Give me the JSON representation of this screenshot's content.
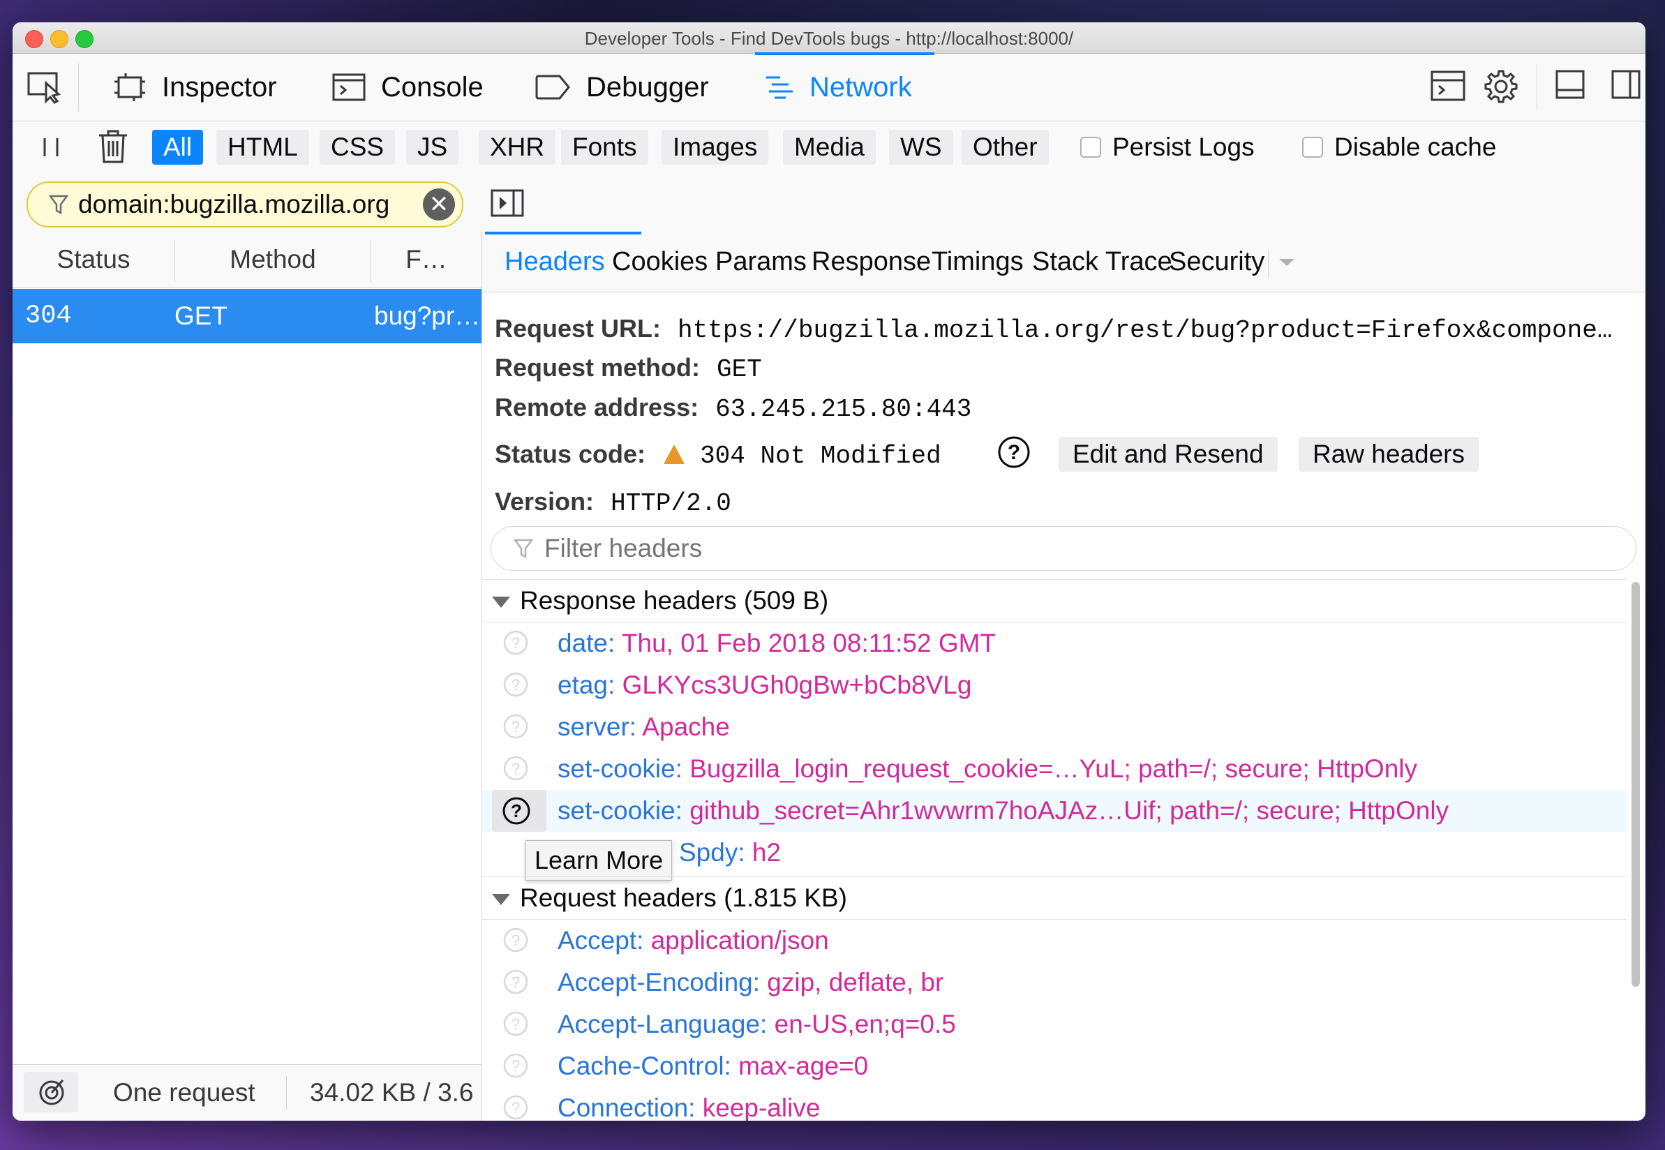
{
  "window": {
    "title": "Developer Tools - Find DevTools bugs - http://localhost:8000/"
  },
  "toolbox": {
    "tabs": [
      {
        "label": "Inspector",
        "icon": "inspector-icon"
      },
      {
        "label": "Console",
        "icon": "console-icon"
      },
      {
        "label": "Debugger",
        "icon": "debugger-icon"
      },
      {
        "label": "Network",
        "icon": "network-icon",
        "selected": true
      }
    ]
  },
  "filters": {
    "types": [
      "All",
      "HTML",
      "CSS",
      "JS",
      "XHR",
      "Fonts",
      "Images",
      "Media",
      "WS",
      "Other"
    ],
    "selected": "All",
    "persist_logs": "Persist Logs",
    "disable_cache": "Disable cache",
    "search_value": "domain:bugzilla.mozilla.org",
    "clear_glyph": "✕"
  },
  "requests": {
    "columns": [
      "Status",
      "Method",
      "F…"
    ],
    "rows": [
      {
        "status": "304",
        "method": "GET",
        "file": "bug?pr…"
      }
    ],
    "summary": "One request",
    "transferred": "34.02 KB / 3.6"
  },
  "details": {
    "tabs": [
      "Headers",
      "Cookies",
      "Params",
      "Response",
      "Timings",
      "Stack Trace",
      "Security"
    ],
    "selected_tab": "Headers",
    "request_url_label": "Request URL:",
    "request_url": "https://bugzilla.mozilla.org/rest/bug?product=Firefox&compone…",
    "request_method_label": "Request method:",
    "request_method": "GET",
    "remote_address_label": "Remote address:",
    "remote_address": "63.245.215.80:443",
    "status_code_label": "Status code:",
    "status_code": "304 Not Modified",
    "edit_resend": "Edit and Resend",
    "raw_headers": "Raw headers",
    "version_label": "Version:",
    "version": "HTTP/2.0",
    "filter_placeholder": "Filter headers",
    "response_headers_title": "Response headers (509 B)",
    "response_headers": [
      {
        "name": "date:",
        "value": "Thu, 01 Feb 2018 08:11:52 GMT"
      },
      {
        "name": "etag:",
        "value": "GLKYcs3UGh0gBw+bCb8VLg"
      },
      {
        "name": "server:",
        "value": "Apache"
      },
      {
        "name": "set-cookie:",
        "value": "Bugzilla_login_request_cookie=…YuL; path=/; secure; HttpOnly"
      },
      {
        "name": "set-cookie:",
        "value": "github_secret=Ahr1wvwrm7hoAJAz…Uif; path=/; secure; HttpOnly"
      },
      {
        "name": "Spdy:",
        "value": "h2"
      }
    ],
    "tooltip": "Learn More",
    "request_headers_title": "Request headers (1.815 KB)",
    "request_headers": [
      {
        "name": "Accept:",
        "value": "application/json"
      },
      {
        "name": "Accept-Encoding:",
        "value": "gzip, deflate, br"
      },
      {
        "name": "Accept-Language:",
        "value": "en-US,en;q=0.5"
      },
      {
        "name": "Cache-Control:",
        "value": "max-age=0"
      },
      {
        "name": "Connection:",
        "value": "keep-alive"
      }
    ]
  },
  "colors": {
    "accent": "#0a84ff",
    "header_name": "#2a75d8",
    "header_value": "#d12a99",
    "selected_row": "#2a8cf0",
    "warning": "#e8952a"
  }
}
